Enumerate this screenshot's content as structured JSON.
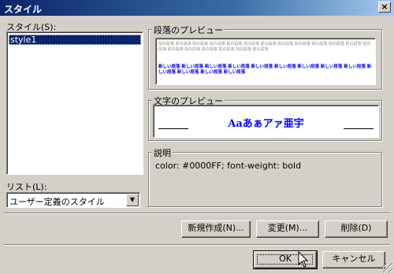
{
  "window": {
    "title": "スタイル",
    "close_glyph": "×"
  },
  "style_list": {
    "label": "スタイル(S):",
    "items": [
      "style1"
    ],
    "selected": "style1"
  },
  "list_filter": {
    "label": "リスト(L):",
    "value": "ユーザー定義のスタイル"
  },
  "paragraph_preview": {
    "label": "段落のプレビュー",
    "grey_text": "前の段落 前の段落 前の段落 前の段落 前の段落 前の段落 前の段落 前の段落 前の段落 前の段落 前の段落 前の段落 前の段落 前の段落 前の段落 前の段落 前の段落 前の段落 前の段落",
    "blue_text": "新しい段落 新しい段落 新しい段落 新しい段落 新しい段落 新しい段落 新しい段落 新しい段落 新しい段落 新しい段落 新しい段落 新しい段落 新しい段落"
  },
  "char_preview": {
    "label": "文字のプレビュー",
    "sample": "Aaあぁアァ亜宇"
  },
  "description": {
    "label": "説明",
    "text": "color: #0000FF; font-weight: bold"
  },
  "buttons": {
    "new": "新規作成(N)...",
    "modify": "変更(M)...",
    "delete": "削除(D)",
    "ok": "OK",
    "cancel": "キャンセル"
  },
  "colors": {
    "selection": "#0a246a",
    "preview_blue": "#0000ff",
    "face": "#d4d0c8"
  }
}
